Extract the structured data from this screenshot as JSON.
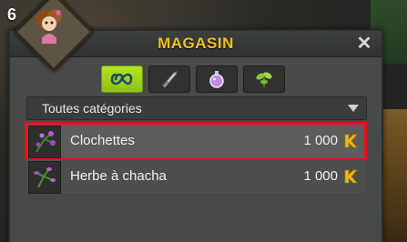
{
  "hud": {
    "counter_text": "6"
  },
  "window": {
    "title": "MAGASIN",
    "close_glyph": "✕"
  },
  "tabs": [
    {
      "name": "all-categories-tab",
      "icon": "infinity-icon",
      "active": true
    },
    {
      "name": "equipment-tab",
      "icon": "sword-icon",
      "active": false
    },
    {
      "name": "consumables-tab",
      "icon": "potion-icon",
      "active": false
    },
    {
      "name": "resources-tab",
      "icon": "plant-icon",
      "active": false
    }
  ],
  "filter": {
    "selected": "Toutes catégories"
  },
  "items": [
    {
      "name": "Clochettes",
      "price": "1 000",
      "currency_icon": "kama-icon",
      "selected": true
    },
    {
      "name": "Herbe à chacha",
      "price": "1 000",
      "currency_icon": "kama-icon",
      "selected": false
    }
  ],
  "colors": {
    "title": "#f2c21b",
    "active_tab": "#b4e31e",
    "selection_outline": "#e0141c",
    "currency": "#f0b81c"
  }
}
